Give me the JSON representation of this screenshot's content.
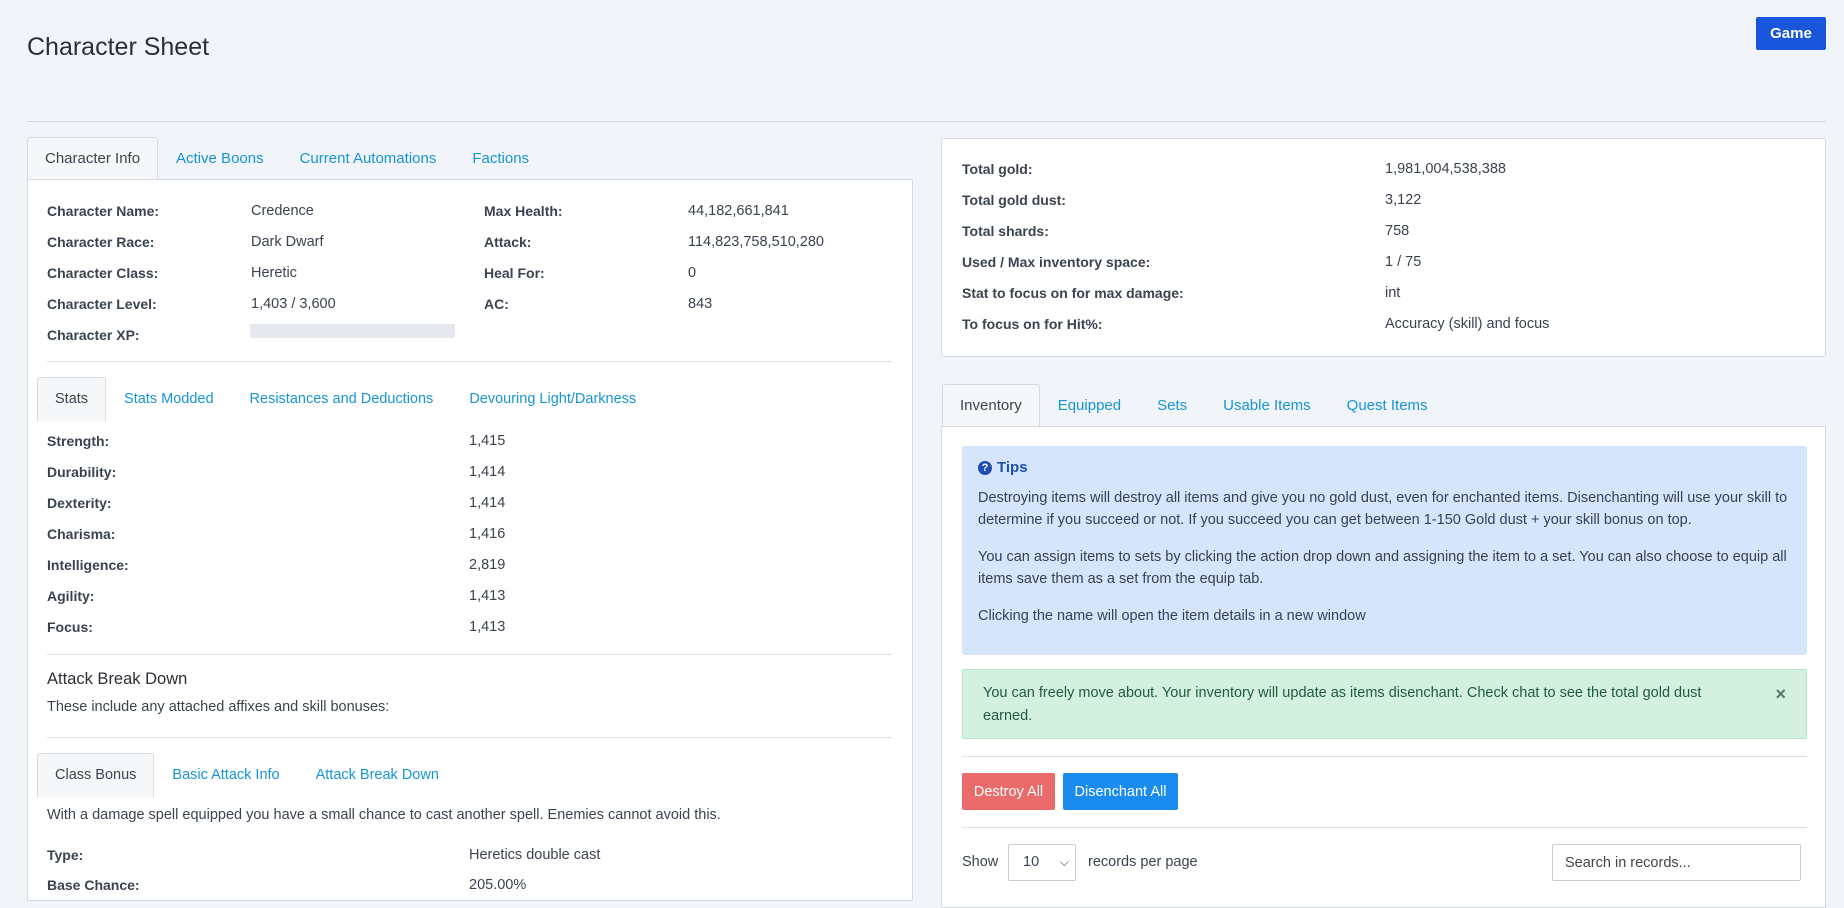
{
  "page": {
    "title": "Character Sheet",
    "game_button": "Game"
  },
  "left_tabs": [
    "Character Info",
    "Active Boons",
    "Current Automations",
    "Factions"
  ],
  "character": {
    "name_label": "Character Name:",
    "name": "Credence",
    "race_label": "Character Race:",
    "race": "Dark Dwarf",
    "class_label": "Character Class:",
    "class": "Heretic",
    "level_label": "Character Level:",
    "level": "1,403 / 3,600",
    "xp_label": "Character XP:",
    "xp_fraction": 0,
    "max_health_label": "Max Health:",
    "max_health": "44,182,661,841",
    "attack_label": "Attack:",
    "attack": "114,823,758,510,280",
    "heal_label": "Heal For:",
    "heal": "0",
    "ac_label": "AC:",
    "ac": "843"
  },
  "stats_tabs": [
    "Stats",
    "Stats Modded",
    "Resistances and Deductions",
    "Devouring Light/Darkness"
  ],
  "stats": [
    {
      "label": "Strength:",
      "value": "1,415"
    },
    {
      "label": "Durability:",
      "value": "1,414"
    },
    {
      "label": "Dexterity:",
      "value": "1,414"
    },
    {
      "label": "Charisma:",
      "value": "1,416"
    },
    {
      "label": "Intelligence:",
      "value": "2,819"
    },
    {
      "label": "Agility:",
      "value": "1,413"
    },
    {
      "label": "Focus:",
      "value": "1,413"
    }
  ],
  "attack_breakdown": {
    "heading": "Attack Break Down",
    "subtitle": "These include any attached affixes and skill bonuses:"
  },
  "class_tabs": [
    "Class Bonus",
    "Basic Attack Info",
    "Attack Break Down"
  ],
  "class_bonus": {
    "description": "With a damage spell equipped you have a small chance to cast another spell. Enemies cannot avoid this.",
    "type_label": "Type:",
    "type": "Heretics double cast",
    "base_chance_label": "Base Chance:",
    "base_chance": "205.00%"
  },
  "summary": [
    {
      "label": "Total gold:",
      "value": "1,981,004,538,388"
    },
    {
      "label": "Total gold dust:",
      "value": "3,122"
    },
    {
      "label": "Total shards:",
      "value": "758"
    },
    {
      "label": "Used / Max inventory space:",
      "value": "1 / 75"
    },
    {
      "label": "Stat to focus on for max damage:",
      "value": "int"
    },
    {
      "label": "To focus on for Hit%:",
      "value": "Accuracy (skill) and focus"
    }
  ],
  "inventory_tabs": [
    "Inventory",
    "Equipped",
    "Sets",
    "Usable Items",
    "Quest Items"
  ],
  "tips": {
    "title": "Tips",
    "p1": "Destroying items will destroy all items and give you no gold dust, even for enchanted items. Disenchanting will use your skill to determine if you succeed or not. If you succeed you can get between 1-150 Gold dust + your skill bonus on top.",
    "p2": "You can assign items to sets by clicking the action drop down and assigning the item to a set. You can also choose to equip all items save them as a set from the equip tab.",
    "p3": "Clicking the name will open the item details in a new window"
  },
  "alert": {
    "text": "You can freely move about. Your inventory will update as items disenchant. Check chat to see the total gold dust earned.",
    "close": "×"
  },
  "actions": {
    "destroy_all": "Destroy All",
    "disenchant_all": "Disenchant All"
  },
  "table_controls": {
    "show_label": "Show",
    "page_size": "10",
    "records_label": "records per page",
    "search_placeholder": "Search in records..."
  },
  "icons": {
    "tips": "question-circle-icon",
    "close": "close-icon",
    "select": "chevron-down-icon"
  },
  "colors": {
    "link": "#1795d5",
    "primary": "#1a56db",
    "danger": "#ea6b6b",
    "info_bg": "#d5e5fb",
    "success_bg": "#d4f1df"
  }
}
